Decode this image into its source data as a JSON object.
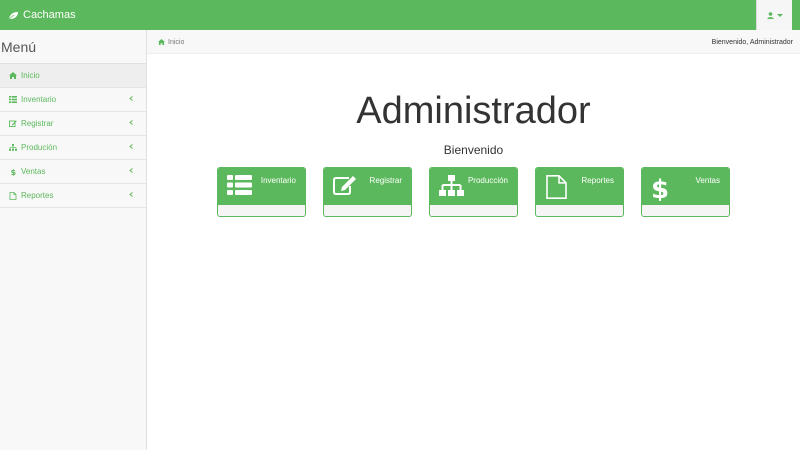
{
  "navbar": {
    "brand": "Cachamas"
  },
  "sidebar": {
    "title": "Menú",
    "items": [
      {
        "label": "Inicio",
        "icon": "home-icon"
      },
      {
        "label": "Inventario",
        "icon": "list-icon"
      },
      {
        "label": "Registrar",
        "icon": "edit-icon"
      },
      {
        "label": "Produción",
        "icon": "sitemap-icon"
      },
      {
        "label": "Ventas",
        "icon": "dollar-icon"
      },
      {
        "label": "Reportes",
        "icon": "file-icon"
      }
    ]
  },
  "breadcrumb": {
    "current": "Inicio",
    "welcome": "Bienvenido, Administrador"
  },
  "main": {
    "title": "Administrador",
    "subtitle": "Bienvenido",
    "tiles": [
      {
        "label": "Inventario",
        "icon": "list-icon"
      },
      {
        "label": "Registrar",
        "icon": "edit-icon"
      },
      {
        "label": "Producción",
        "icon": "sitemap-icon"
      },
      {
        "label": "Reportes",
        "icon": "file-icon"
      },
      {
        "label": "Ventas",
        "icon": "dollar-icon"
      }
    ]
  },
  "colors": {
    "accent": "#5cb85c",
    "sidebar_bg": "#f8f8f8",
    "text": "#333333"
  }
}
